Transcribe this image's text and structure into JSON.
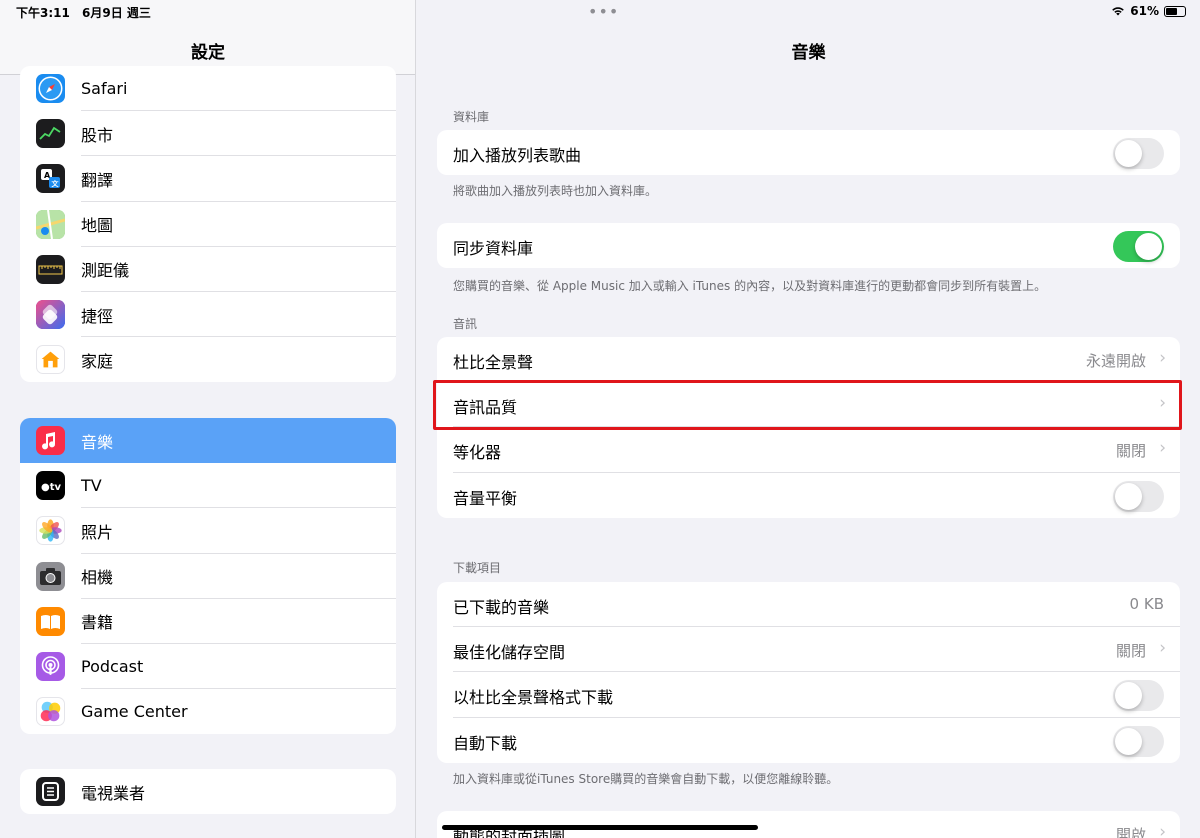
{
  "status": {
    "time": "下午3:11",
    "date": "6月9日 週三",
    "battery": "61%",
    "battery_level": 0.61
  },
  "sidebar": {
    "title": "設定",
    "group1": [
      {
        "label": "Safari",
        "icon": "safari-icon",
        "color": "#1a8cf0"
      },
      {
        "label": "股市",
        "icon": "stocks-icon",
        "color": "#1c1c1e"
      },
      {
        "label": "翻譯",
        "icon": "translate-icon",
        "color": "#1c1c1e"
      },
      {
        "label": "地圖",
        "icon": "maps-icon",
        "color": "#6cc36a"
      },
      {
        "label": "測距儀",
        "icon": "measure-icon",
        "color": "#1c1c1e"
      },
      {
        "label": "捷徑",
        "icon": "shortcuts-icon",
        "color": "#4a3cc8"
      },
      {
        "label": "家庭",
        "icon": "home-icon",
        "color": "#ffffff"
      }
    ],
    "group2": [
      {
        "label": "音樂",
        "icon": "music-icon",
        "color": "#fa2d48",
        "selected": true
      },
      {
        "label": "TV",
        "icon": "tv-icon",
        "color": "#000000",
        "glyph": "tv"
      },
      {
        "label": "照片",
        "icon": "photos-icon",
        "color": "#ffffff"
      },
      {
        "label": "相機",
        "icon": "camera-icon",
        "color": "#8e8e93"
      },
      {
        "label": "書籍",
        "icon": "books-icon",
        "color": "#ff8a00"
      },
      {
        "label": "Podcast",
        "icon": "podcast-icon",
        "color": "#a65ae6"
      },
      {
        "label": "Game Center",
        "icon": "game-center-icon",
        "color": "#ffffff"
      }
    ],
    "group3": [
      {
        "label": "電視業者",
        "icon": "tv-provider-icon",
        "color": "#1c1c1e"
      }
    ]
  },
  "main": {
    "title": "音樂",
    "library": {
      "header": "資料庫",
      "add_playlist": {
        "label": "加入播放列表歌曲",
        "toggle": false
      },
      "add_playlist_footer": "將歌曲加入播放列表時也加入資料庫。",
      "sync": {
        "label": "同步資料庫",
        "toggle": true
      },
      "sync_footer": "您購買的音樂、從 Apple Music 加入或輸入 iTunes 的內容，以及對資料庫進行的更動都會同步到所有裝置上。"
    },
    "audio": {
      "header": "音訊",
      "dolby": {
        "label": "杜比全景聲",
        "value": "永遠開啟"
      },
      "quality": {
        "label": "音訊品質"
      },
      "eq": {
        "label": "等化器",
        "value": "關閉"
      },
      "volume": {
        "label": "音量平衡",
        "toggle": false
      }
    },
    "downloads": {
      "header": "下載項目",
      "downloaded": {
        "label": "已下載的音樂",
        "value": "0 KB"
      },
      "optimize": {
        "label": "最佳化儲存空間",
        "value": "關閉"
      },
      "dolby_dl": {
        "label": "以杜比全景聲格式下載",
        "toggle": false
      },
      "auto": {
        "label": "自動下載",
        "toggle": false
      },
      "footer": "加入資料庫或從iTunes Store購買的音樂會自動下載，以便您離線聆聽。"
    },
    "partial": {
      "label": "動態的封面插圖",
      "value": "開啟"
    }
  }
}
